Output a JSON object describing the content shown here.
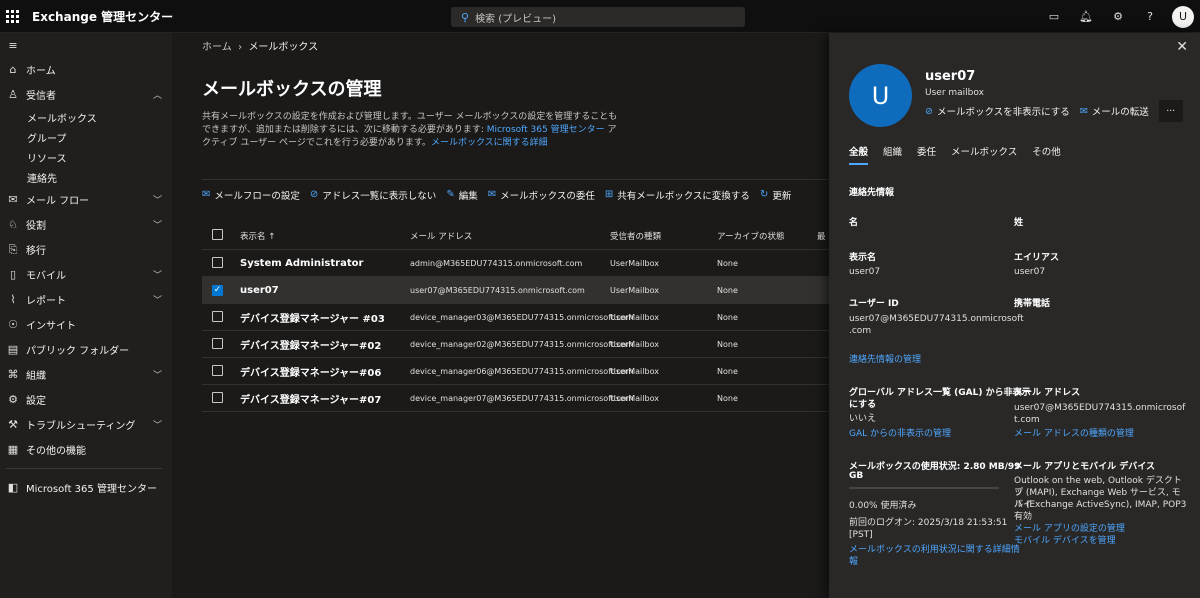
{
  "topbar": {
    "title": "Exchange 管理センター",
    "search_placeholder": "検索 (プレビュー)",
    "avatar_initial": "U"
  },
  "sidebar": {
    "items": [
      {
        "label": "ホーム",
        "icon": "home-icon"
      },
      {
        "label": "受信者",
        "icon": "person-icon",
        "expanded": true
      },
      {
        "label": "メールボックス",
        "sub": true
      },
      {
        "label": "グループ",
        "sub": true
      },
      {
        "label": "リソース",
        "sub": true
      },
      {
        "label": "連絡先",
        "sub": true
      },
      {
        "label": "メール フロー",
        "icon": "mail-flow-icon"
      },
      {
        "label": "役割",
        "icon": "roles-icon"
      },
      {
        "label": "移行",
        "icon": "migration-icon"
      },
      {
        "label": "モバイル",
        "icon": "mobile-icon"
      },
      {
        "label": "レポート",
        "icon": "report-icon"
      },
      {
        "label": "インサイト",
        "icon": "insight-icon"
      },
      {
        "label": "パブリック フォルダー",
        "icon": "folder-icon"
      },
      {
        "label": "組織",
        "icon": "organization-icon"
      },
      {
        "label": "設定",
        "icon": "settings-icon"
      },
      {
        "label": "トラブルシューティング",
        "icon": "troubleshoot-icon"
      },
      {
        "label": "その他の機能",
        "icon": "grid-icon"
      }
    ],
    "footer": "Microsoft 365 管理センター"
  },
  "main": {
    "breadcrumb_home": "ホーム",
    "breadcrumb_current": "メールボックス",
    "title": "メールボックスの管理",
    "desc_part1": "共有メールボックスの設定を作成および管理します。ユーザー メールボックスの設定を管理することもできますが、追加または削除するには、次に移動する必要があります: ",
    "desc_link1": "Microsoft 365 管理センター",
    "desc_part2": " アクティブ ユーザー ページでこれを行う必要があります。",
    "desc_link2": "メールボックスに関する詳細",
    "commands": [
      "メールフローの設定",
      "アドレス一覧に表示しない",
      "編集",
      "メールボックスの委任",
      "共有メールボックスに変換する",
      "更新"
    ],
    "columns": [
      "表示名 ↑",
      "メール アドレス",
      "受信者の種類",
      "アーカイブの状態",
      "最"
    ],
    "rows": [
      {
        "name": "System Administrator",
        "email": "admin@M365EDU774315.onmicrosoft.com",
        "type": "UserMailbox",
        "archive": "None",
        "selected": false
      },
      {
        "name": "user07",
        "email": "user07@M365EDU774315.onmicrosoft.com",
        "type": "UserMailbox",
        "archive": "None",
        "selected": true
      },
      {
        "name": "デバイス登録マネージャー #03",
        "email": "device_manager03@M365EDU774315.onmicrosoft.com",
        "type": "UserMailbox",
        "archive": "None",
        "selected": false
      },
      {
        "name": "デバイス登録マネージャー#02",
        "email": "device_manager02@M365EDU774315.onmicrosoft.com",
        "type": "UserMailbox",
        "archive": "None",
        "selected": false
      },
      {
        "name": "デバイス登録マネージャー#06",
        "email": "device_manager06@M365EDU774315.onmicrosoft.com",
        "type": "UserMailbox",
        "archive": "None",
        "selected": false
      },
      {
        "name": "デバイス登録マネージャー#07",
        "email": "device_manager07@M365EDU774315.onmicrosoft.com",
        "type": "UserMailbox",
        "archive": "None",
        "selected": false
      }
    ]
  },
  "panel": {
    "initial": "U",
    "name": "user07",
    "type": "User mailbox",
    "action_hide": "メールボックスを非表示にする",
    "action_forward": "メールの転送",
    "more": "···",
    "tabs": [
      "全般",
      "組織",
      "委任",
      "メールボックス",
      "その他"
    ],
    "contact_header": "連絡先情報",
    "first_name_label": "名",
    "last_name_label": "姓",
    "display_name_label": "表示名",
    "display_name": "user07",
    "alias_label": "エイリアス",
    "alias": "user07",
    "user_id_label": "ユーザー ID",
    "user_id_1": "user07@M365EDU774315.onmicrosoft",
    "user_id_2": ".com",
    "phone_label": "携帯電話",
    "manage_contact": "連絡先情報の管理",
    "gal_label_1": "グローバル アドレス一覧 (GAL) から非表示",
    "gal_label_2": "にする",
    "gal_value": "いいえ",
    "gal_manage": "GAL からの非表示の管理",
    "email_label": "メール アドレス",
    "email_1": "user07@M365EDU774315.onmicrosof",
    "email_2": "t.com",
    "email_manage": "メール アドレスの種類の管理",
    "usage_label_1": "メールボックスの使用状況: 2.80 MB/99",
    "usage_label_2": "GB",
    "usage_percent": "0.00% 使用済み",
    "usage_fraction": 0.0003,
    "last_logon_1": "前回のログオン: 2025/3/18 21:53:51",
    "last_logon_2": "[PST]",
    "usage_link_1": "メールボックスの利用状況に関する詳細情",
    "usage_link_2": "報",
    "apps_label": "メール アプリとモバイル デバイス",
    "apps_1": "Outlook on the web, Outlook デスクトッ",
    "apps_2": "プ (MAPI), Exchange Web サービス, モバイ",
    "apps_3": "ル (Exchange ActiveSync), IMAP, POP3",
    "apps_4": "有効",
    "apps_manage": "メール アプリの設定の管理",
    "mobile_manage": "モバイル デバイスを管理"
  }
}
